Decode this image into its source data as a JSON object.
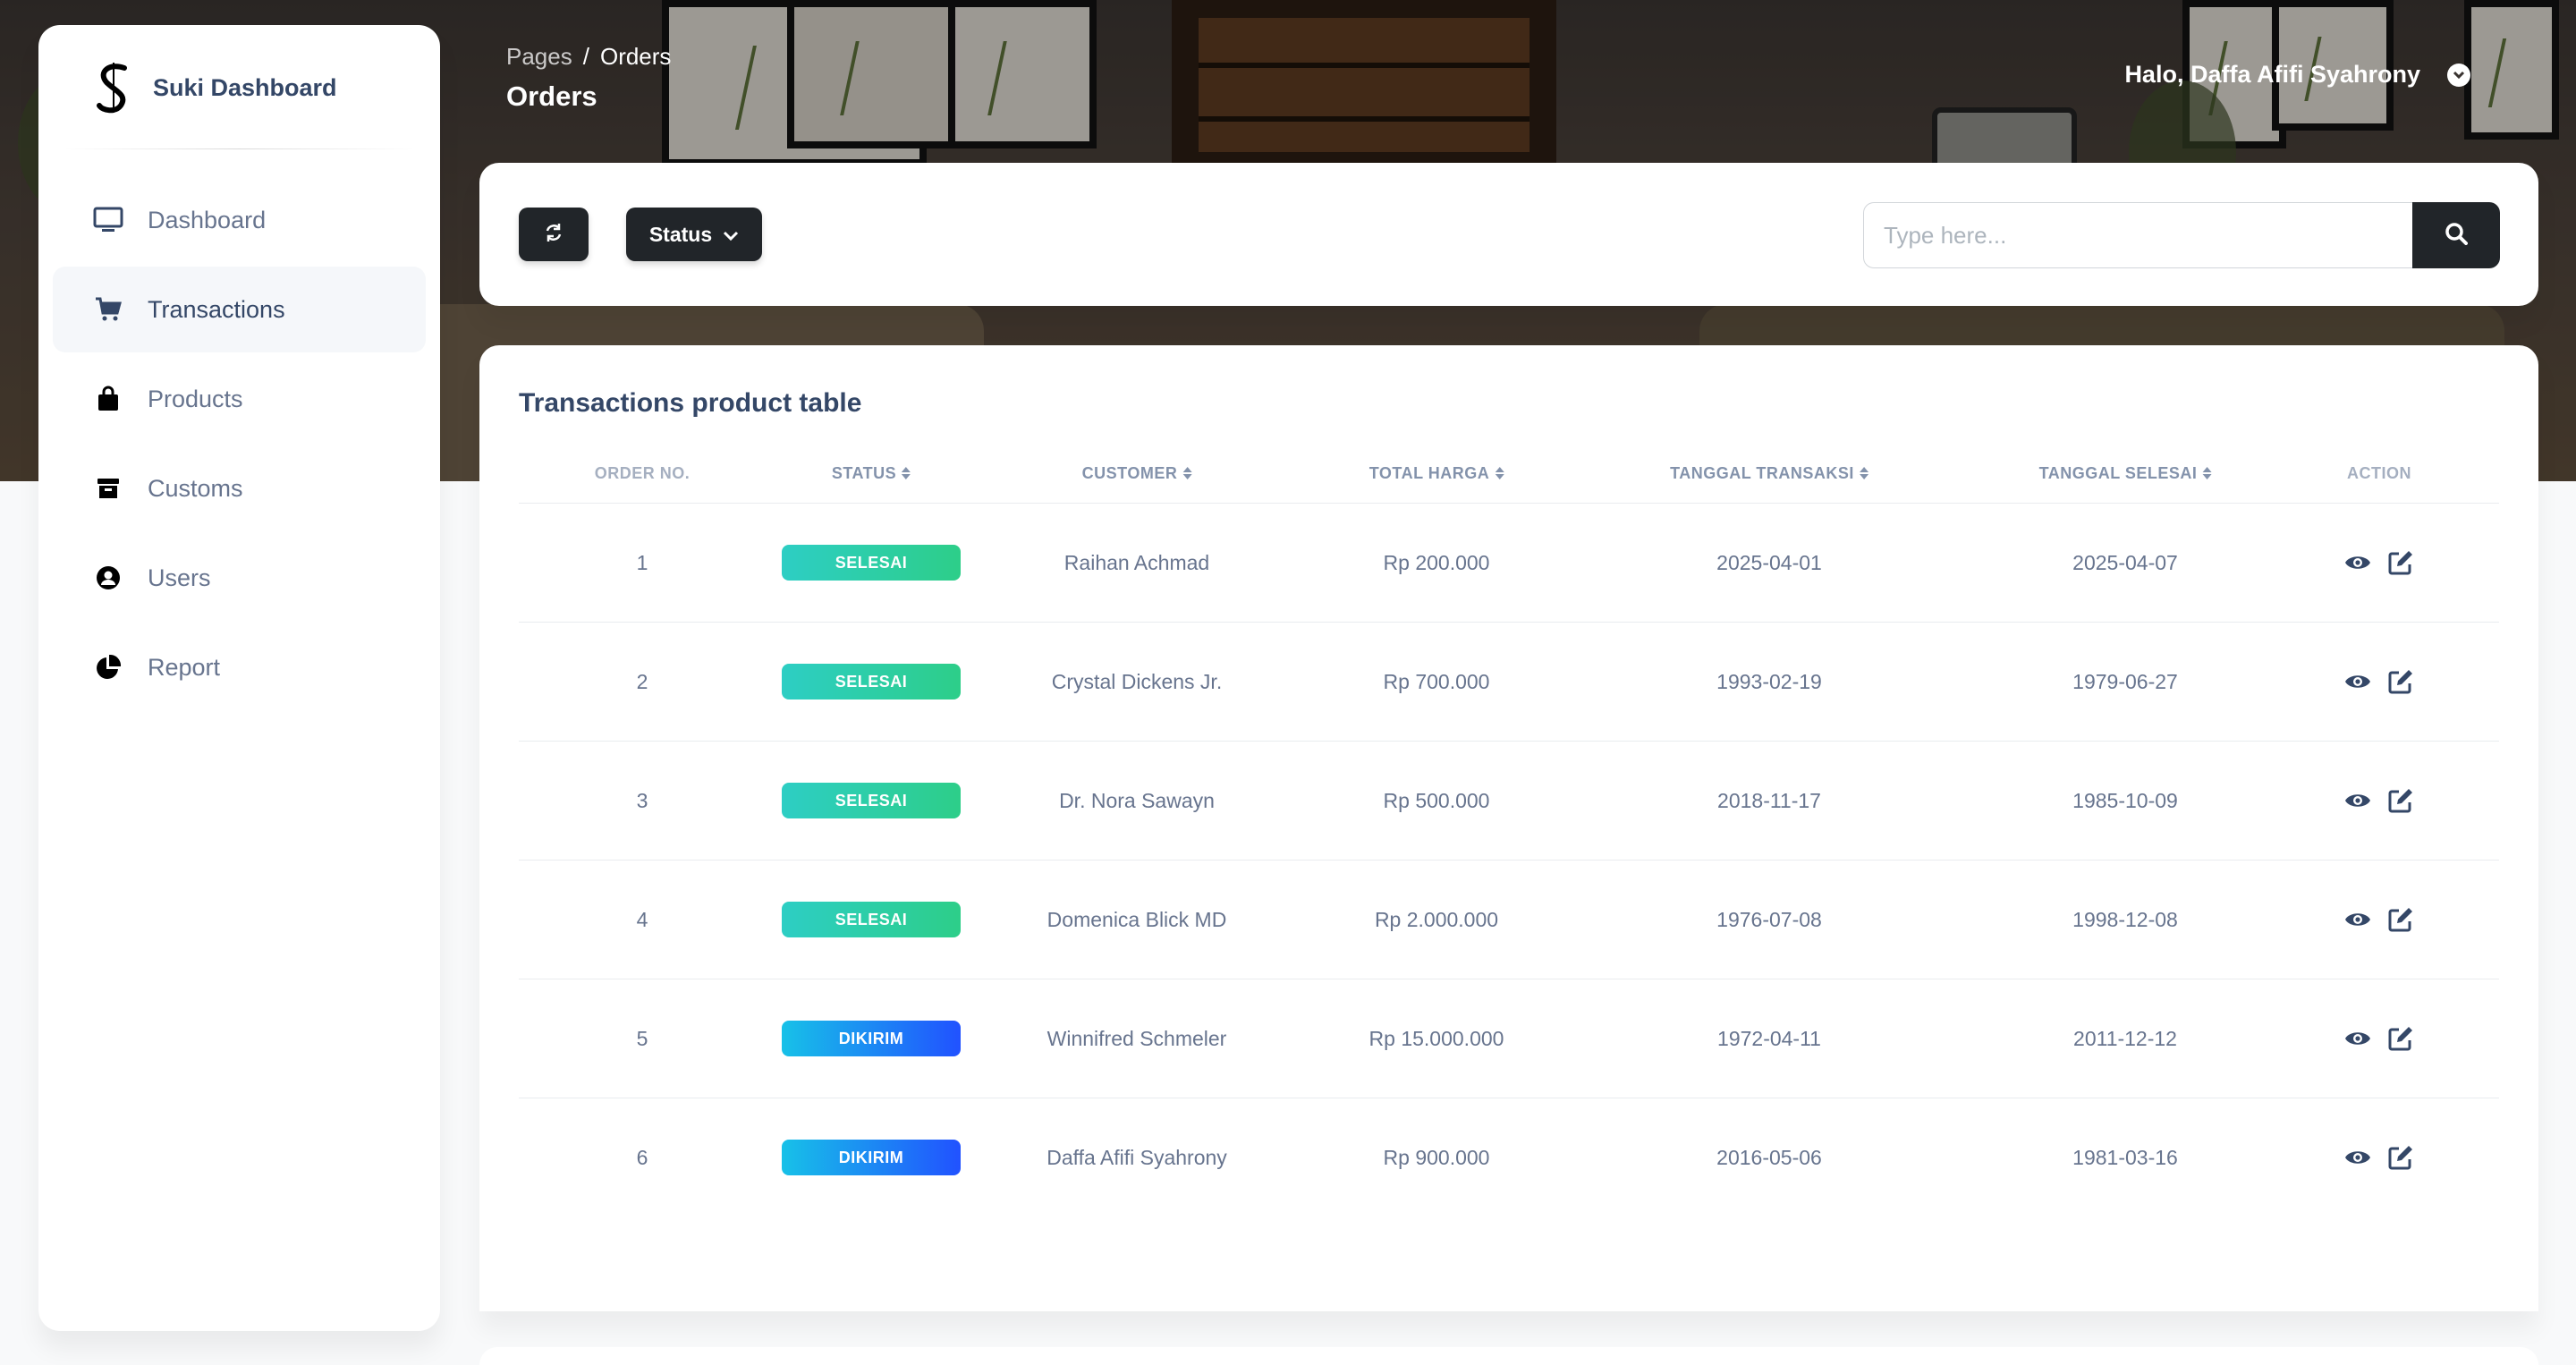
{
  "brand": {
    "name": "Suki Dashboard",
    "logo_icon": "brand-s-logo"
  },
  "sidebar": {
    "items": [
      {
        "label": "Dashboard",
        "icon": "monitor-icon",
        "active": false
      },
      {
        "label": "Transactions",
        "icon": "cart-icon",
        "active": true
      },
      {
        "label": "Products",
        "icon": "bag-icon",
        "active": false
      },
      {
        "label": "Customs",
        "icon": "archive-icon",
        "active": false
      },
      {
        "label": "Users",
        "icon": "user-circle-icon",
        "active": false
      },
      {
        "label": "Report",
        "icon": "pie-chart-icon",
        "active": false
      }
    ]
  },
  "header": {
    "breadcrumb_root": "Pages",
    "breadcrumb_separator": "/",
    "breadcrumb_current": "Orders",
    "title": "Orders",
    "user_greeting": "Halo, Daffa Afifi Syahrony"
  },
  "filters": {
    "refresh_icon": "refresh-icon",
    "status_label": "Status",
    "search_placeholder": "Type here...",
    "search_value": ""
  },
  "table": {
    "title": "Transactions product table",
    "columns": [
      {
        "label": "ORDER NO.",
        "sortable": false
      },
      {
        "label": "STATUS",
        "sortable": true
      },
      {
        "label": "CUSTOMER",
        "sortable": true
      },
      {
        "label": "TOTAL HARGA",
        "sortable": true
      },
      {
        "label": "TANGGAL TRANSAKSI",
        "sortable": true
      },
      {
        "label": "TANGGAL SELESAI",
        "sortable": true
      },
      {
        "label": "ACTION",
        "sortable": false
      }
    ],
    "rows": [
      {
        "no": "1",
        "status": "SELESAI",
        "customer": "Raihan Achmad",
        "total": "Rp 200.000",
        "tgl_transaksi": "2025-04-01",
        "tgl_selesai": "2025-04-07"
      },
      {
        "no": "2",
        "status": "SELESAI",
        "customer": "Crystal Dickens Jr.",
        "total": "Rp 700.000",
        "tgl_transaksi": "1993-02-19",
        "tgl_selesai": "1979-06-27"
      },
      {
        "no": "3",
        "status": "SELESAI",
        "customer": "Dr. Nora Sawayn",
        "total": "Rp 500.000",
        "tgl_transaksi": "2018-11-17",
        "tgl_selesai": "1985-10-09"
      },
      {
        "no": "4",
        "status": "SELESAI",
        "customer": "Domenica Blick MD",
        "total": "Rp 2.000.000",
        "tgl_transaksi": "1976-07-08",
        "tgl_selesai": "1998-12-08"
      },
      {
        "no": "5",
        "status": "DIKIRIM",
        "customer": "Winnifred Schmeler",
        "total": "Rp 15.000.000",
        "tgl_transaksi": "1972-04-11",
        "tgl_selesai": "2011-12-12"
      },
      {
        "no": "6",
        "status": "DIKIRIM",
        "customer": "Daffa Afifi Syahrony",
        "total": "Rp 900.000",
        "tgl_transaksi": "2016-05-06",
        "tgl_selesai": "1981-03-16"
      }
    ]
  },
  "colors": {
    "selesai": "#2dce89",
    "dikirim": "#2152ff",
    "dark_button": "#212529",
    "text_primary": "#344767",
    "text_secondary": "#67748e"
  }
}
